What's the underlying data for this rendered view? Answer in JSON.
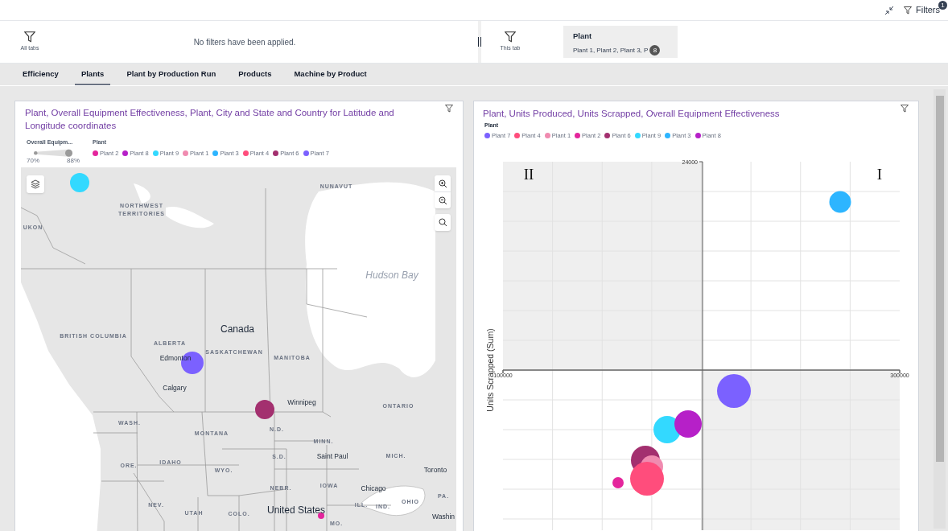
{
  "top_bar": {
    "filters_label": "Filters",
    "filters_badge": "1"
  },
  "filter_panel": {
    "all_tabs_label": "All tabs",
    "empty_message": "No filters have been applied.",
    "this_tab_label": "This tab",
    "chips": [
      {
        "title": "Plant",
        "values": "Plant 1, Plant 2, Plant 3, P",
        "count": "8"
      }
    ]
  },
  "tabs": [
    {
      "label": "Efficiency",
      "selected": false
    },
    {
      "label": "Plants",
      "selected": true
    },
    {
      "label": "Plant by Production Run",
      "selected": false
    },
    {
      "label": "Products",
      "selected": false
    },
    {
      "label": "Machine by Product",
      "selected": false
    }
  ],
  "map_card": {
    "title": "Plant, Overall Equipment Effectiveness, Plant, City and State and Country for Latitude and Longitude coordinates",
    "size_legend": {
      "title": "Overall Equipm...",
      "min": "70%",
      "max": "88%"
    },
    "legend": {
      "title": "Plant",
      "items": [
        {
          "label": "Plant 2",
          "color": "#e4259c"
        },
        {
          "label": "Plant 8",
          "color": "#b620c8"
        },
        {
          "label": "Plant 9",
          "color": "#33d9ff"
        },
        {
          "label": "Plant 1",
          "color": "#f08bb0"
        },
        {
          "label": "Plant 3",
          "color": "#2db5ff"
        },
        {
          "label": "Plant 4",
          "color": "#ff4d7c"
        },
        {
          "label": "Plant 6",
          "color": "#a3306f"
        },
        {
          "label": "Plant 7",
          "color": "#7b61ff"
        }
      ]
    },
    "map_labels": [
      {
        "text": "NUNAVUT",
        "kind": "region"
      },
      {
        "text": "NORTHWEST TERRITORIES",
        "kind": "region"
      },
      {
        "text": "UKON",
        "kind": "region"
      },
      {
        "text": "Hudson Bay",
        "kind": "water"
      },
      {
        "text": "BRITISH COLUMBIA",
        "kind": "region"
      },
      {
        "text": "ALBERTA",
        "kind": "region"
      },
      {
        "text": "Canada",
        "kind": "country"
      },
      {
        "text": "SASKATCHEWAN",
        "kind": "region"
      },
      {
        "text": "MANITOBA",
        "kind": "region"
      },
      {
        "text": "Edmonton",
        "kind": "city"
      },
      {
        "text": "Calgary",
        "kind": "city"
      },
      {
        "text": "Winnipeg",
        "kind": "city"
      },
      {
        "text": "ONTARIO",
        "kind": "region"
      },
      {
        "text": "WASH.",
        "kind": "region"
      },
      {
        "text": "MONTANA",
        "kind": "region"
      },
      {
        "text": "N.D.",
        "kind": "region"
      },
      {
        "text": "MINN.",
        "kind": "region"
      },
      {
        "text": "Saint Paul",
        "kind": "city"
      },
      {
        "text": "MICH.",
        "kind": "region"
      },
      {
        "text": "Toronto",
        "kind": "city"
      },
      {
        "text": "ORE.",
        "kind": "region"
      },
      {
        "text": "IDAHO",
        "kind": "region"
      },
      {
        "text": "WYO.",
        "kind": "region"
      },
      {
        "text": "S.D.",
        "kind": "region"
      },
      {
        "text": "NEBR.",
        "kind": "region"
      },
      {
        "text": "IOWA",
        "kind": "region"
      },
      {
        "text": "Chicago",
        "kind": "city"
      },
      {
        "text": "PA.",
        "kind": "region"
      },
      {
        "text": "NEV.",
        "kind": "region"
      },
      {
        "text": "UTAH",
        "kind": "region"
      },
      {
        "text": "COLO.",
        "kind": "region"
      },
      {
        "text": "United States",
        "kind": "country"
      },
      {
        "text": "ILL.",
        "kind": "region"
      },
      {
        "text": "IND.",
        "kind": "region"
      },
      {
        "text": "OHIO",
        "kind": "region"
      },
      {
        "text": "MO.",
        "kind": "region"
      },
      {
        "text": "Washin",
        "kind": "city"
      }
    ],
    "markers": [
      {
        "color": "#33d9ff"
      },
      {
        "color": "#7b61ff"
      },
      {
        "color": "#a3306f"
      },
      {
        "color": "#e4259c"
      }
    ]
  },
  "scatter_card": {
    "title": "Plant, Units Produced, Units Scrapped, Overall Equipment Effectiveness",
    "legend": {
      "title": "Plant",
      "items": [
        {
          "label": "Plant 7",
          "color": "#7b61ff"
        },
        {
          "label": "Plant 4",
          "color": "#ff4d7c"
        },
        {
          "label": "Plant 1",
          "color": "#f08bb0"
        },
        {
          "label": "Plant 2",
          "color": "#e4259c"
        },
        {
          "label": "Plant 6",
          "color": "#a3306f"
        },
        {
          "label": "Plant 9",
          "color": "#33d9ff"
        },
        {
          "label": "Plant 3",
          "color": "#2db5ff"
        },
        {
          "label": "Plant 8",
          "color": "#b620c8"
        }
      ]
    },
    "y_axis_label": "Units Scrapped (Sum)",
    "y_tick": "24000",
    "x_ticks": [
      "100000",
      "300000"
    ],
    "quadrants": [
      "II",
      "I"
    ],
    "bubbles": [
      {
        "color": "#2db5ff"
      },
      {
        "color": "#7b61ff"
      },
      {
        "color": "#33d9ff"
      },
      {
        "color": "#b620c8"
      },
      {
        "color": "#a3306f"
      },
      {
        "color": "#f08bb0"
      },
      {
        "color": "#ff4d7c"
      },
      {
        "color": "#e4259c"
      }
    ]
  }
}
